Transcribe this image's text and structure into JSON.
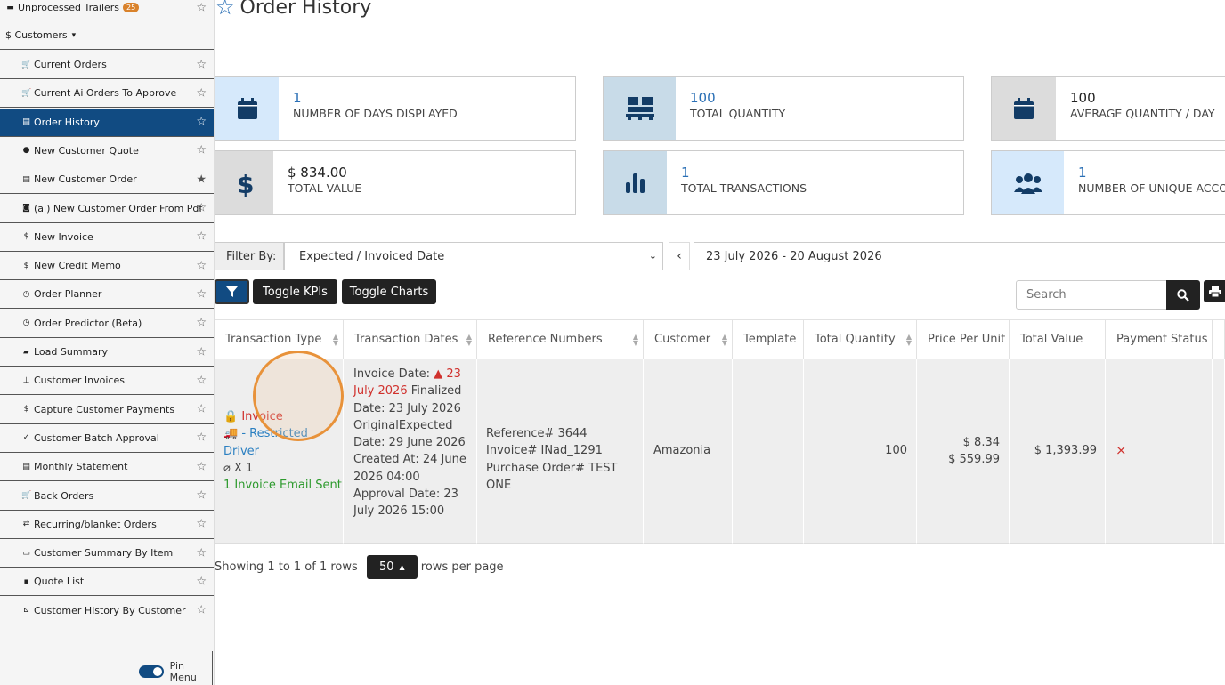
{
  "sidebar": {
    "top_item": {
      "label": "Unprocessed Trailers",
      "badge": "25"
    },
    "section": {
      "label": "$ Customers",
      "caret": "▾"
    },
    "items": [
      {
        "icon": "cart-icon",
        "glyph": "🛒",
        "label": "Current Orders",
        "starred": false,
        "active": false
      },
      {
        "icon": "cart-icon",
        "glyph": "🛒",
        "label": "Current Ai Orders To Approve",
        "starred": false,
        "active": false
      },
      {
        "icon": "document-icon",
        "glyph": "▤",
        "label": "Order History",
        "starred": false,
        "active": true
      },
      {
        "icon": "comment-icon",
        "glyph": "●",
        "label": "New Customer Quote",
        "starred": false,
        "active": false
      },
      {
        "icon": "list-icon",
        "glyph": "▤",
        "label": "New Customer Order",
        "starred": true,
        "active": false
      },
      {
        "icon": "robot-icon",
        "glyph": "◙",
        "label": "(ai) New Customer Order From Pdf",
        "starred": false,
        "active": false
      },
      {
        "icon": "dollar-icon",
        "glyph": "$",
        "label": "New Invoice",
        "starred": false,
        "active": false
      },
      {
        "icon": "dollar-icon",
        "glyph": "$",
        "label": "New Credit Memo",
        "starred": false,
        "active": false
      },
      {
        "icon": "clock-icon",
        "glyph": "◷",
        "label": "Order Planner",
        "starred": false,
        "active": false
      },
      {
        "icon": "clock-icon",
        "glyph": "◷",
        "label": "Order Predictor (Beta)",
        "starred": false,
        "active": false
      },
      {
        "icon": "truck-icon",
        "glyph": "▰",
        "label": "Load Summary",
        "starred": false,
        "active": false
      },
      {
        "icon": "inbox-icon",
        "glyph": "⊥",
        "label": "Customer Invoices",
        "starred": false,
        "active": false
      },
      {
        "icon": "dollar-icon",
        "glyph": "$",
        "label": "Capture Customer Payments",
        "starred": false,
        "active": false
      },
      {
        "icon": "check-icon",
        "glyph": "✓",
        "label": "Customer Batch Approval",
        "starred": false,
        "active": false
      },
      {
        "icon": "statement-icon",
        "glyph": "▤",
        "label": "Monthly Statement",
        "starred": false,
        "active": false
      },
      {
        "icon": "cart-icon",
        "glyph": "🛒",
        "label": "Back Orders",
        "starred": false,
        "active": false
      },
      {
        "icon": "repeat-icon",
        "glyph": "⇄",
        "label": "Recurring/blanket Orders",
        "starred": false,
        "active": false
      },
      {
        "icon": "summary-icon",
        "glyph": "▭",
        "label": "Customer Summary By Item",
        "starred": false,
        "active": false
      },
      {
        "icon": "quote-icon",
        "glyph": "▪",
        "label": "Quote List",
        "starred": false,
        "active": false
      },
      {
        "icon": "chart-icon",
        "glyph": "⊾",
        "label": "Customer History By Customer",
        "starred": false,
        "active": false
      }
    ],
    "pin_menu_label": "Pin Menu"
  },
  "header": {
    "title": "Order History"
  },
  "kpis": [
    {
      "value": "1",
      "label": "NUMBER OF DAYS DISPLAYED",
      "icon": "calendar-icon",
      "icon_bg": "#d6e9fb",
      "value_color": "#2a6fb5"
    },
    {
      "value": "100",
      "label": "TOTAL QUANTITY",
      "icon": "pallet-icon",
      "icon_bg": "#c8dbe8",
      "value_color": "#2a6fb5"
    },
    {
      "value": "100",
      "label": "AVERAGE QUANTITY / DAY",
      "icon": "calendar-icon",
      "icon_bg": "#dcdcdc",
      "value_color": "#222"
    },
    {
      "value": "$ 834.00",
      "label": "TOTAL VALUE",
      "icon": "dollar-icon",
      "icon_bg": "#dcdcdc",
      "value_color": "#222"
    },
    {
      "value": "1",
      "label": "TOTAL TRANSACTIONS",
      "icon": "bar-chart-icon",
      "icon_bg": "#c8dbe8",
      "value_color": "#2a6fb5"
    },
    {
      "value": "1",
      "label": "NUMBER OF UNIQUE ACCO",
      "icon": "users-icon",
      "icon_bg": "#d6e9fb",
      "value_color": "#2a6fb5"
    }
  ],
  "filters": {
    "label": "Filter By:",
    "selected": "Expected / Invoiced Date",
    "date_range": "23 July 2026 - 20 August 2026"
  },
  "toolbar": {
    "toggle_kpis": "Toggle KPIs",
    "toggle_charts": "Toggle Charts",
    "search_placeholder": "Search"
  },
  "table": {
    "columns": [
      "Transaction Type",
      "Transaction Dates",
      "Reference Numbers",
      "Customer",
      "Template",
      "Total Quantity",
      "Price Per Unit",
      "Total Value",
      "Payment Status"
    ],
    "row": {
      "type_invoice": "Invoice",
      "type_restricted": "- Restricted Driver",
      "type_attach": "X 1",
      "type_email": "1 Invoice Email Sent",
      "dates_invoice_label": "Invoice Date:",
      "dates_invoice_value": "23 July 2026",
      "dates_rest": "Finalized Date: 23 July 2026 OriginalExpected Date: 29 June 2026 Created At: 24 June 2026 04:00 Approval Date: 23 July 2026 15:00",
      "ref_1": "Reference# 3644",
      "ref_2": "Invoice# INad_1291",
      "ref_3": "Purchase Order# TEST ONE",
      "customer": "Amazonia",
      "template": "",
      "quantity": "100",
      "price_1": "$ 8.34",
      "price_2": "$ 559.99",
      "total_value": "$ 1,393.99",
      "payment_status": "×"
    }
  },
  "pager": {
    "showing": "Showing 1 to 1 of 1 rows",
    "page_size": "50",
    "per_page": "rows per page"
  }
}
